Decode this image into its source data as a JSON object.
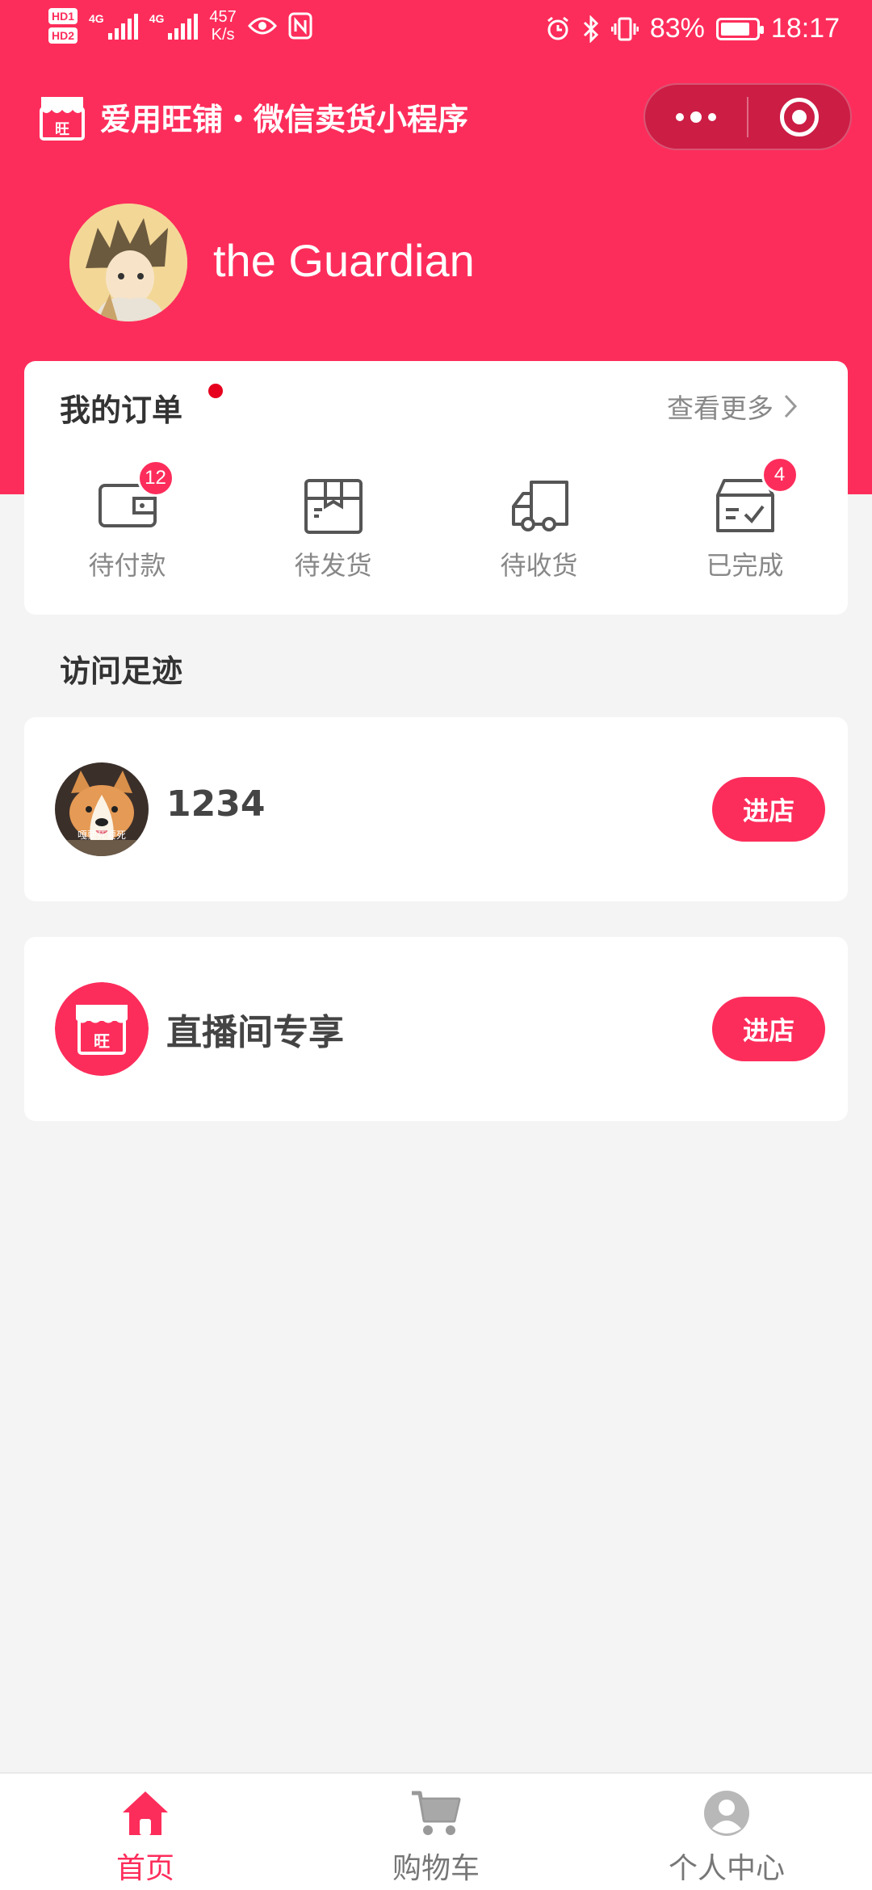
{
  "status_bar": {
    "hd1": "HD1",
    "hd2": "HD2",
    "net1": "4G",
    "net2": "4G",
    "speed_value": "457",
    "speed_unit": "K/s",
    "battery": "83%",
    "battery_level": 0.83,
    "time": "18:17"
  },
  "app": {
    "title": "爱用旺铺・微信卖货小程序",
    "accent_color": "#fd2d5b"
  },
  "profile": {
    "username": "the Guardian"
  },
  "orders": {
    "title": "我的订单",
    "more_label": "查看更多",
    "items": [
      {
        "label": "待付款",
        "icon": "wallet-icon",
        "badge": "12"
      },
      {
        "label": "待发货",
        "icon": "package-icon",
        "badge": ""
      },
      {
        "label": "待收货",
        "icon": "truck-icon",
        "badge": ""
      },
      {
        "label": "已完成",
        "icon": "completed-box-icon",
        "badge": "4"
      }
    ]
  },
  "footprints": {
    "title": "访问足迹",
    "shops": [
      {
        "name": "1234",
        "avatar_caption": "嘎要死要死",
        "enter_label": "进店"
      },
      {
        "name": "直播间专享",
        "logo_text": "旺",
        "enter_label": "进店"
      }
    ]
  },
  "tabbar": {
    "items": [
      {
        "label": "首页",
        "icon": "home-icon",
        "active": true
      },
      {
        "label": "购物车",
        "icon": "cart-icon",
        "active": false
      },
      {
        "label": "个人中心",
        "icon": "user-icon",
        "active": false
      }
    ]
  }
}
